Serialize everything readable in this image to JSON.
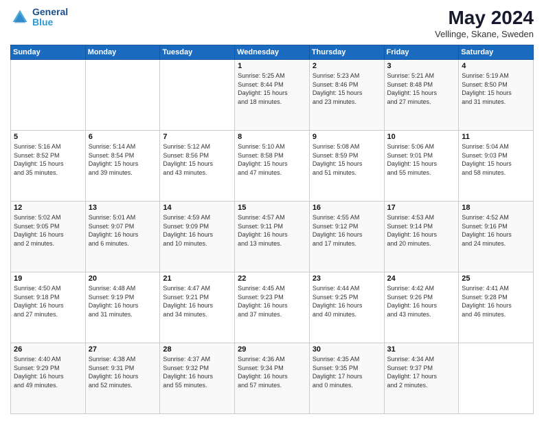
{
  "header": {
    "logo_line1": "General",
    "logo_line2": "Blue",
    "month_title": "May 2024",
    "location": "Vellinge, Skane, Sweden"
  },
  "weekdays": [
    "Sunday",
    "Monday",
    "Tuesday",
    "Wednesday",
    "Thursday",
    "Friday",
    "Saturday"
  ],
  "weeks": [
    [
      {
        "day": "",
        "info": ""
      },
      {
        "day": "",
        "info": ""
      },
      {
        "day": "",
        "info": ""
      },
      {
        "day": "1",
        "info": "Sunrise: 5:25 AM\nSunset: 8:44 PM\nDaylight: 15 hours\nand 18 minutes."
      },
      {
        "day": "2",
        "info": "Sunrise: 5:23 AM\nSunset: 8:46 PM\nDaylight: 15 hours\nand 23 minutes."
      },
      {
        "day": "3",
        "info": "Sunrise: 5:21 AM\nSunset: 8:48 PM\nDaylight: 15 hours\nand 27 minutes."
      },
      {
        "day": "4",
        "info": "Sunrise: 5:19 AM\nSunset: 8:50 PM\nDaylight: 15 hours\nand 31 minutes."
      }
    ],
    [
      {
        "day": "5",
        "info": "Sunrise: 5:16 AM\nSunset: 8:52 PM\nDaylight: 15 hours\nand 35 minutes."
      },
      {
        "day": "6",
        "info": "Sunrise: 5:14 AM\nSunset: 8:54 PM\nDaylight: 15 hours\nand 39 minutes."
      },
      {
        "day": "7",
        "info": "Sunrise: 5:12 AM\nSunset: 8:56 PM\nDaylight: 15 hours\nand 43 minutes."
      },
      {
        "day": "8",
        "info": "Sunrise: 5:10 AM\nSunset: 8:58 PM\nDaylight: 15 hours\nand 47 minutes."
      },
      {
        "day": "9",
        "info": "Sunrise: 5:08 AM\nSunset: 8:59 PM\nDaylight: 15 hours\nand 51 minutes."
      },
      {
        "day": "10",
        "info": "Sunrise: 5:06 AM\nSunset: 9:01 PM\nDaylight: 15 hours\nand 55 minutes."
      },
      {
        "day": "11",
        "info": "Sunrise: 5:04 AM\nSunset: 9:03 PM\nDaylight: 15 hours\nand 58 minutes."
      }
    ],
    [
      {
        "day": "12",
        "info": "Sunrise: 5:02 AM\nSunset: 9:05 PM\nDaylight: 16 hours\nand 2 minutes."
      },
      {
        "day": "13",
        "info": "Sunrise: 5:01 AM\nSunset: 9:07 PM\nDaylight: 16 hours\nand 6 minutes."
      },
      {
        "day": "14",
        "info": "Sunrise: 4:59 AM\nSunset: 9:09 PM\nDaylight: 16 hours\nand 10 minutes."
      },
      {
        "day": "15",
        "info": "Sunrise: 4:57 AM\nSunset: 9:11 PM\nDaylight: 16 hours\nand 13 minutes."
      },
      {
        "day": "16",
        "info": "Sunrise: 4:55 AM\nSunset: 9:12 PM\nDaylight: 16 hours\nand 17 minutes."
      },
      {
        "day": "17",
        "info": "Sunrise: 4:53 AM\nSunset: 9:14 PM\nDaylight: 16 hours\nand 20 minutes."
      },
      {
        "day": "18",
        "info": "Sunrise: 4:52 AM\nSunset: 9:16 PM\nDaylight: 16 hours\nand 24 minutes."
      }
    ],
    [
      {
        "day": "19",
        "info": "Sunrise: 4:50 AM\nSunset: 9:18 PM\nDaylight: 16 hours\nand 27 minutes."
      },
      {
        "day": "20",
        "info": "Sunrise: 4:48 AM\nSunset: 9:19 PM\nDaylight: 16 hours\nand 31 minutes."
      },
      {
        "day": "21",
        "info": "Sunrise: 4:47 AM\nSunset: 9:21 PM\nDaylight: 16 hours\nand 34 minutes."
      },
      {
        "day": "22",
        "info": "Sunrise: 4:45 AM\nSunset: 9:23 PM\nDaylight: 16 hours\nand 37 minutes."
      },
      {
        "day": "23",
        "info": "Sunrise: 4:44 AM\nSunset: 9:25 PM\nDaylight: 16 hours\nand 40 minutes."
      },
      {
        "day": "24",
        "info": "Sunrise: 4:42 AM\nSunset: 9:26 PM\nDaylight: 16 hours\nand 43 minutes."
      },
      {
        "day": "25",
        "info": "Sunrise: 4:41 AM\nSunset: 9:28 PM\nDaylight: 16 hours\nand 46 minutes."
      }
    ],
    [
      {
        "day": "26",
        "info": "Sunrise: 4:40 AM\nSunset: 9:29 PM\nDaylight: 16 hours\nand 49 minutes."
      },
      {
        "day": "27",
        "info": "Sunrise: 4:38 AM\nSunset: 9:31 PM\nDaylight: 16 hours\nand 52 minutes."
      },
      {
        "day": "28",
        "info": "Sunrise: 4:37 AM\nSunset: 9:32 PM\nDaylight: 16 hours\nand 55 minutes."
      },
      {
        "day": "29",
        "info": "Sunrise: 4:36 AM\nSunset: 9:34 PM\nDaylight: 16 hours\nand 57 minutes."
      },
      {
        "day": "30",
        "info": "Sunrise: 4:35 AM\nSunset: 9:35 PM\nDaylight: 17 hours\nand 0 minutes."
      },
      {
        "day": "31",
        "info": "Sunrise: 4:34 AM\nSunset: 9:37 PM\nDaylight: 17 hours\nand 2 minutes."
      },
      {
        "day": "",
        "info": ""
      }
    ]
  ]
}
